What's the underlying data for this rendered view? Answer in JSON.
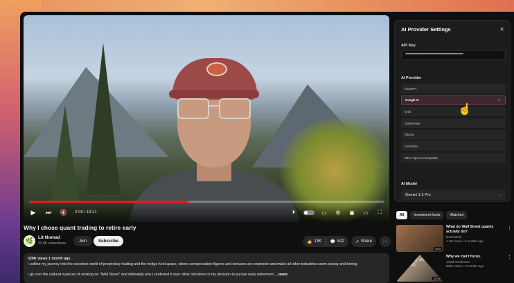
{
  "video": {
    "current_time": "0:09",
    "duration": "19:21",
    "progress": 0.45
  },
  "title": "Why I chose quant trading to retire early",
  "channel": {
    "name": "Lit Nomad",
    "subscribers": "33.8K subscribers",
    "join_label": "Join",
    "subscribe_label": "Subscribe"
  },
  "actions": {
    "likes": "13K",
    "comments": "522",
    "share_label": "Share"
  },
  "description": {
    "stats": "329K views  1 month ago",
    "line1": "I outline my journey into the secretive world of proprietary trading and the hedge fund space, where compensation figures and bonuses are explosive and make all other industries seem sleepy and boring.",
    "line2": "I go over the cultural nuances of working on \"Wall Street\" and ultimately why I preferred it over other industries in my decision to pursue early retirement.",
    "more_label": "...more"
  },
  "settings": {
    "title": "AI Provider Settings",
    "api_key_label": "API Key",
    "api_key_value": "••••••••••••••••••••••••••••••••••••••••••••••••••••",
    "provider_label": "AI Provider",
    "providers": [
      "ChatGPT",
      "Google AI",
      "Grok",
      "OpenRouter",
      "Ollama",
      "LM Studio",
      "Other OpenAI Compatible"
    ],
    "selected_provider": "Google AI",
    "model_label": "AI Model",
    "model_value": "Gemini 1.5 Pro"
  },
  "chips": [
    "All",
    "Investment funds",
    "Watched"
  ],
  "recommendations": [
    {
      "title": "What do Wall Street quants actually do?",
      "channel": "Read Work",
      "meta": "1.1M views • 3 months ago",
      "duration": "9:03"
    },
    {
      "title": "Why we can't focus.",
      "channel": "Jared Henderson",
      "meta": "942K views • 3 months ago",
      "duration": "12:40",
      "thumb_text": "Amusing ourselves to death"
    }
  ],
  "colors": {
    "accent_red": "#e62117",
    "panel_bg": "#1c1c1c",
    "page_bg": "#0f0f0f"
  }
}
